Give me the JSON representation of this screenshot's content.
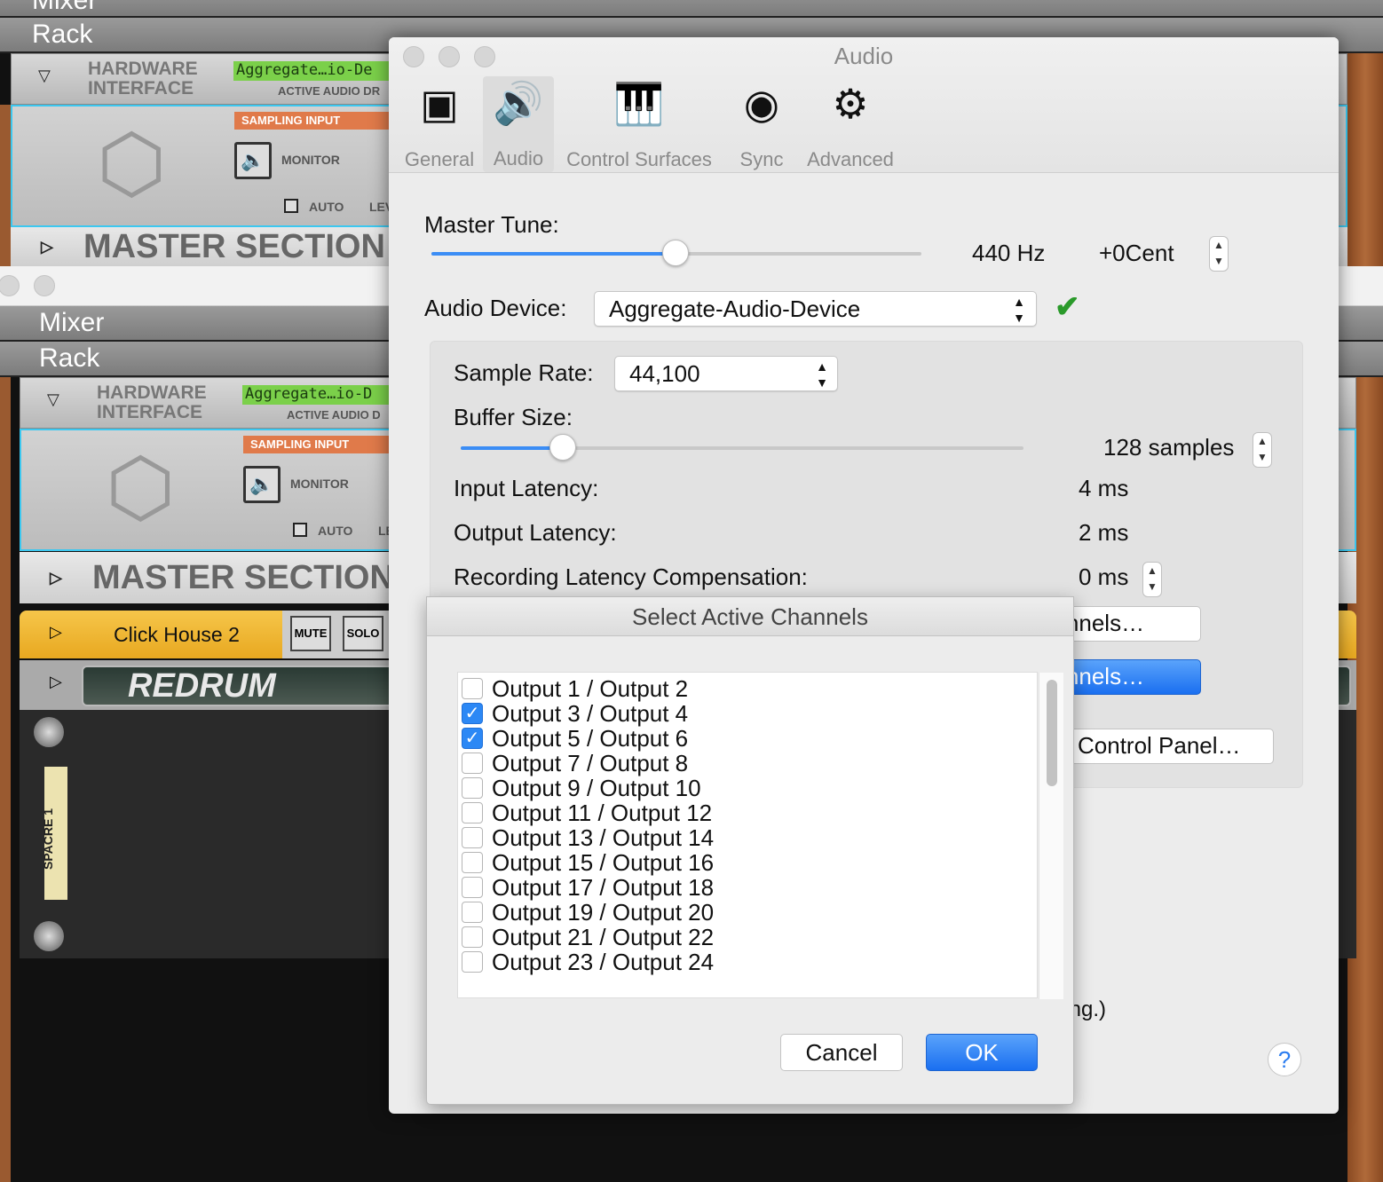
{
  "background_app": {
    "window1": {
      "mixer_label": "Mixer",
      "rack_label": "Rack",
      "hw_title_1": "HARDWARE",
      "hw_title_2": "INTERFACE",
      "lcd": "Aggregate…io-De",
      "active_audio": "ACTIVE AUDIO DR",
      "sampling_input": "SAMPLING INPUT",
      "monitor": "MONITOR",
      "auto": "AUTO",
      "level": "LEV",
      "master_section": "MASTER SECTION"
    },
    "window2": {
      "mixer_label": "Mixer",
      "rack_label": "Rack",
      "hw_title_1": "HARDWARE",
      "hw_title_2": "INTERFACE",
      "lcd": "Aggregate…io-D",
      "active_audio": "ACTIVE AUDIO D",
      "sampling_input": "SAMPLING INPUT",
      "monitor": "MONITOR",
      "auto": "AUTO",
      "level": "LE",
      "master_section": "MASTER SECTION",
      "click_house": "Click House 2",
      "mute": "MUTE",
      "solo": "SOLO",
      "redrum": "REDRUM",
      "spacre": "SPACRE 1"
    }
  },
  "dialog": {
    "title": "Audio",
    "tabs": [
      {
        "label": "General",
        "icon": "general-icon"
      },
      {
        "label": "Audio",
        "icon": "speaker-icon",
        "active": true
      },
      {
        "label": "Control Surfaces",
        "icon": "keyboard-icon"
      },
      {
        "label": "Sync",
        "icon": "midi-sync-icon"
      },
      {
        "label": "Advanced",
        "icon": "gear-icon"
      }
    ],
    "master_tune": {
      "label": "Master Tune:",
      "hz": "440 Hz",
      "cent": "+0Cent",
      "slider_fraction": 0.5
    },
    "audio_device": {
      "label": "Audio Device:",
      "value": "Aggregate-Audio-Device",
      "status": "ok",
      "status_color": "#2a9a2a"
    },
    "sample_rate": {
      "label": "Sample Rate:",
      "value": "44,100"
    },
    "buffer_size": {
      "label": "Buffer Size:",
      "value": "128 samples",
      "slider_fraction": 0.18
    },
    "input_latency": {
      "label": "Input Latency:",
      "value": "4 ms"
    },
    "output_latency": {
      "label": "Output Latency:",
      "value": "2 ms"
    },
    "rec_latency": {
      "label": "Recording Latency Compensation:",
      "value": "0 ms"
    },
    "channels_btn_1": "hannels…",
    "channels_btn_2": "hannels…",
    "control_panel_btn": "Control Panel…",
    "partial_text": "pring.)",
    "help": "?"
  },
  "sheet": {
    "title": "Select Active Channels",
    "channels": [
      {
        "label": "Output 1 / Output 2",
        "checked": false
      },
      {
        "label": "Output 3 / Output 4",
        "checked": true
      },
      {
        "label": "Output 5 / Output 6",
        "checked": true
      },
      {
        "label": "Output 7 / Output 8",
        "checked": false
      },
      {
        "label": "Output 9 / Output 10",
        "checked": false
      },
      {
        "label": "Output 11 / Output 12",
        "checked": false
      },
      {
        "label": "Output 13 / Output 14",
        "checked": false
      },
      {
        "label": "Output 15 / Output 16",
        "checked": false
      },
      {
        "label": "Output 17 / Output 18",
        "checked": false
      },
      {
        "label": "Output 19 / Output 20",
        "checked": false
      },
      {
        "label": "Output 21 / Output 22",
        "checked": false
      },
      {
        "label": "Output 23 / Output 24",
        "checked": false
      }
    ],
    "cancel": "Cancel",
    "ok": "OK",
    "accent": "#2c88f5"
  }
}
